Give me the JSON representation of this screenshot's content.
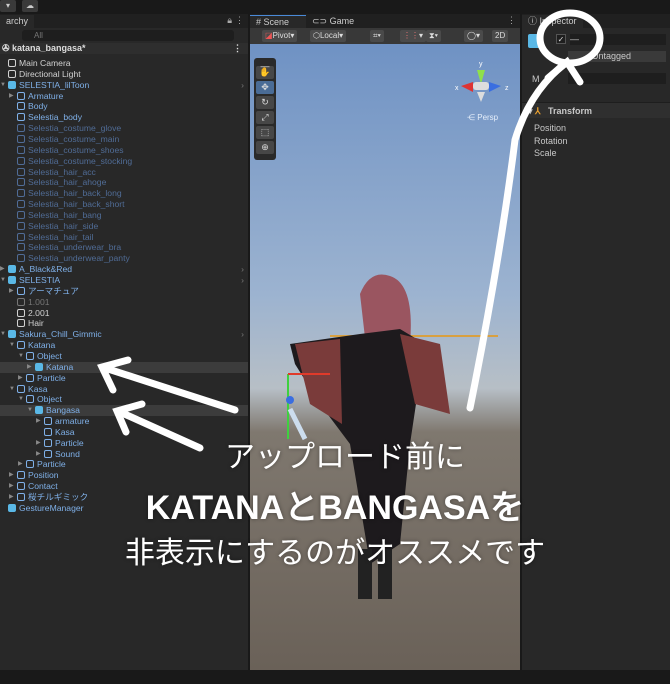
{
  "topbar": {
    "dropdown": "▾",
    "cloud_icon": "cloud-icon"
  },
  "hierarchy": {
    "tab": "archy",
    "search_placeholder": "All",
    "scene_name": "katana_bangasa*",
    "rows": [
      {
        "label": "Main Camera",
        "depth": 0,
        "style": "white"
      },
      {
        "label": "Directional Light",
        "depth": 0,
        "style": "white"
      },
      {
        "label": "SELESTIA_lilToon",
        "depth": 0,
        "style": "blue",
        "prefab": true,
        "expanded": true,
        "chev": true
      },
      {
        "label": "Armature",
        "depth": 1,
        "style": "blue",
        "collapsed": true
      },
      {
        "label": "Body",
        "depth": 1,
        "style": "blue"
      },
      {
        "label": "Selestia_body",
        "depth": 1,
        "style": "blue"
      },
      {
        "label": "Selestia_costume_glove",
        "depth": 1,
        "style": "dim"
      },
      {
        "label": "Selestia_costume_main",
        "depth": 1,
        "style": "dim"
      },
      {
        "label": "Selestia_costume_shoes",
        "depth": 1,
        "style": "dim"
      },
      {
        "label": "Selestia_costume_stocking",
        "depth": 1,
        "style": "dim"
      },
      {
        "label": "Selestia_hair_acc",
        "depth": 1,
        "style": "dim"
      },
      {
        "label": "Selestia_hair_ahoge",
        "depth": 1,
        "style": "dim"
      },
      {
        "label": "Selestia_hair_back_long",
        "depth": 1,
        "style": "dim"
      },
      {
        "label": "Selestia_hair_back_short",
        "depth": 1,
        "style": "dim"
      },
      {
        "label": "Selestia_hair_bang",
        "depth": 1,
        "style": "dim"
      },
      {
        "label": "Selestia_hair_side",
        "depth": 1,
        "style": "dim"
      },
      {
        "label": "Selestia_hair_tail",
        "depth": 1,
        "style": "dim"
      },
      {
        "label": "Selestia_underwear_bra",
        "depth": 1,
        "style": "dim"
      },
      {
        "label": "Selestia_underwear_panty",
        "depth": 1,
        "style": "dim"
      },
      {
        "label": "A_Black&Red",
        "depth": 0,
        "style": "blue",
        "prefab": true,
        "collapsed": true,
        "chev": true
      },
      {
        "label": "SELESTIA",
        "depth": 0,
        "style": "blue",
        "prefab": true,
        "expanded": true,
        "chev": true
      },
      {
        "label": "アーマチュア",
        "depth": 1,
        "style": "blue",
        "collapsed": true
      },
      {
        "label": "1.001",
        "depth": 1,
        "style": "gray"
      },
      {
        "label": "2.001",
        "depth": 1,
        "style": "white"
      },
      {
        "label": "Hair",
        "depth": 1,
        "style": "white"
      },
      {
        "label": "Sakura_Chill_Gimmic",
        "depth": 0,
        "style": "blue",
        "prefab": true,
        "expanded": true,
        "chev": true
      },
      {
        "label": "Katana",
        "depth": 1,
        "style": "blue",
        "expanded": true
      },
      {
        "label": "Object",
        "depth": 2,
        "style": "blue",
        "expanded": true
      },
      {
        "label": "Katana",
        "depth": 3,
        "style": "blue",
        "prefab": true,
        "collapsed": true,
        "selected": true
      },
      {
        "label": "Particle",
        "depth": 2,
        "style": "blue",
        "collapsed": true
      },
      {
        "label": "Kasa",
        "depth": 1,
        "style": "blue",
        "expanded": true
      },
      {
        "label": "Object",
        "depth": 2,
        "style": "blue",
        "expanded": true
      },
      {
        "label": "Bangasa",
        "depth": 3,
        "style": "blue",
        "prefab": true,
        "expanded": true,
        "selected": true
      },
      {
        "label": "armature",
        "depth": 4,
        "style": "blue",
        "collapsed": true
      },
      {
        "label": "Kasa",
        "depth": 4,
        "style": "blue"
      },
      {
        "label": "Particle",
        "depth": 4,
        "style": "blue",
        "collapsed": true
      },
      {
        "label": "Sound",
        "depth": 4,
        "style": "blue",
        "collapsed": true
      },
      {
        "label": "Particle",
        "depth": 2,
        "style": "blue",
        "collapsed": true
      },
      {
        "label": "Position",
        "depth": 1,
        "style": "blue",
        "collapsed": true
      },
      {
        "label": "Contact",
        "depth": 1,
        "style": "blue",
        "collapsed": true
      },
      {
        "label": "桜チルギミック",
        "depth": 1,
        "style": "blue",
        "collapsed": true
      },
      {
        "label": "GestureManager",
        "depth": 0,
        "style": "blue",
        "prefab": true
      }
    ]
  },
  "scene": {
    "tabs": [
      "Scene",
      "Game"
    ],
    "toolbar": {
      "pivot": "Pivot",
      "local": "Local",
      "mode_2d": "2D"
    },
    "gizmo": {
      "x": "x",
      "y": "y",
      "z": "z",
      "projection": "Persp"
    }
  },
  "inspector": {
    "tab": "Inspector",
    "tag": "Untagged",
    "field_label": "M",
    "component": "Transform",
    "fields": [
      "Position",
      "Rotation",
      "Scale"
    ],
    "active_checked": true
  },
  "annotation": {
    "line1": "アップロード前に",
    "line2": "KATANAとBANGASAを",
    "line3": "非表示にするのがオススメです"
  }
}
